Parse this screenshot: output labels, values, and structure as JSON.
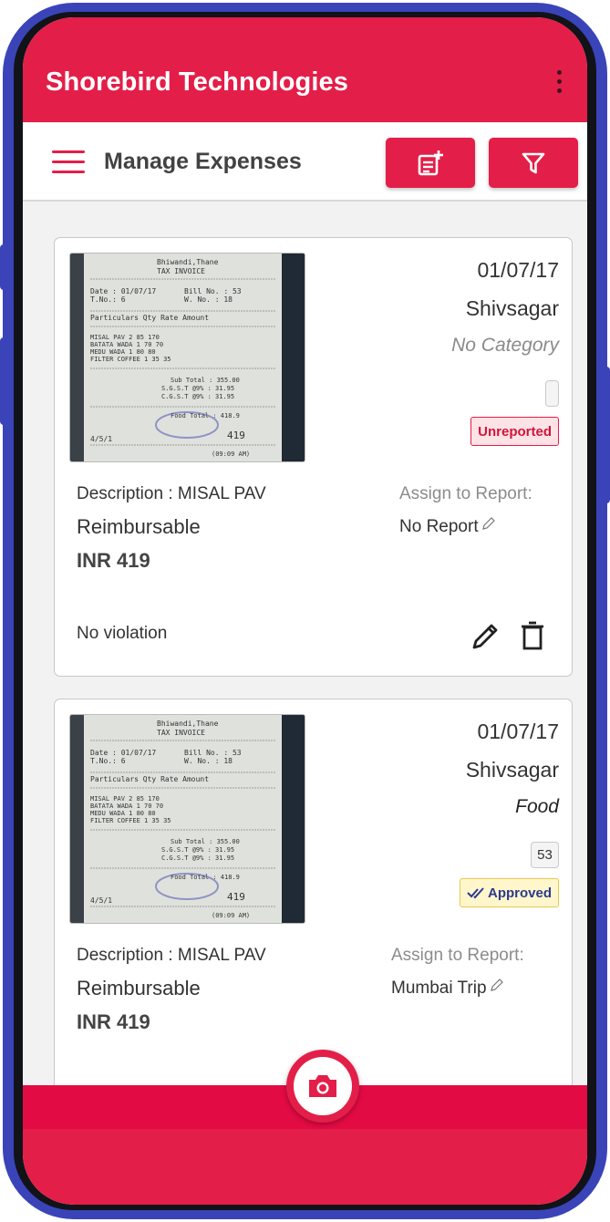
{
  "app": {
    "title": "Shorebird Technologies"
  },
  "toolbar": {
    "page_title": "Manage Expenses"
  },
  "icons": {
    "menu": "hamburger-icon",
    "overflow": "more-vert-icon",
    "add": "add-report-icon",
    "filter": "filter-icon",
    "edit": "pencil-icon",
    "delete": "trash-icon",
    "camera": "camera-icon",
    "approved": "double-check-icon"
  },
  "colors": {
    "primary": "#e31e48",
    "unreported": "#d2143c",
    "approved_bg": "#fff6cc",
    "approved_text": "#2b3a8c"
  },
  "expenses": [
    {
      "date": "01/07/17",
      "merchant": "Shivsagar",
      "category": "No Category",
      "bill_no": "",
      "status": "Unreported",
      "description": "Description : MISAL PAV",
      "type": "Reimbursable",
      "amount": "INR 419",
      "assign_label": "Assign to Report:",
      "report": "No Report",
      "violation": "No violation"
    },
    {
      "date": "01/07/17",
      "merchant": "Shivsagar",
      "category": "Food",
      "bill_no": "53",
      "status": "Approved",
      "description": "Description : MISAL PAV",
      "type": "Reimbursable",
      "amount": "INR 419",
      "assign_label": "Assign to Report:",
      "report": "Mumbai Trip"
    }
  ],
  "receipt": {
    "header": "Bhiwandi,Thane",
    "title": "TAX INVOICE",
    "date": "Date : 01/07/17",
    "bill": "Bill No. : 53",
    "table_no": "T.No.: 6",
    "waiter": "W. No. : 18",
    "columns": "Particulars     Qty Rate  Amount",
    "items": [
      "MISAL PAV          2   85    170",
      "BATATA WADA        1   70     70",
      "MEDU WADA          1   80     80",
      "FILTER COFFEE      1   35     35"
    ],
    "subtotal": "Sub Total :   355.00",
    "sgst": "S.G.S.T @9% :   31.95",
    "cgst": "C.G.S.T @9% :   31.95",
    "food_total": "Food Total :   418.9",
    "grand": "419",
    "footer_left": "4/5/1",
    "footer_time": "(09:09 AM)"
  }
}
